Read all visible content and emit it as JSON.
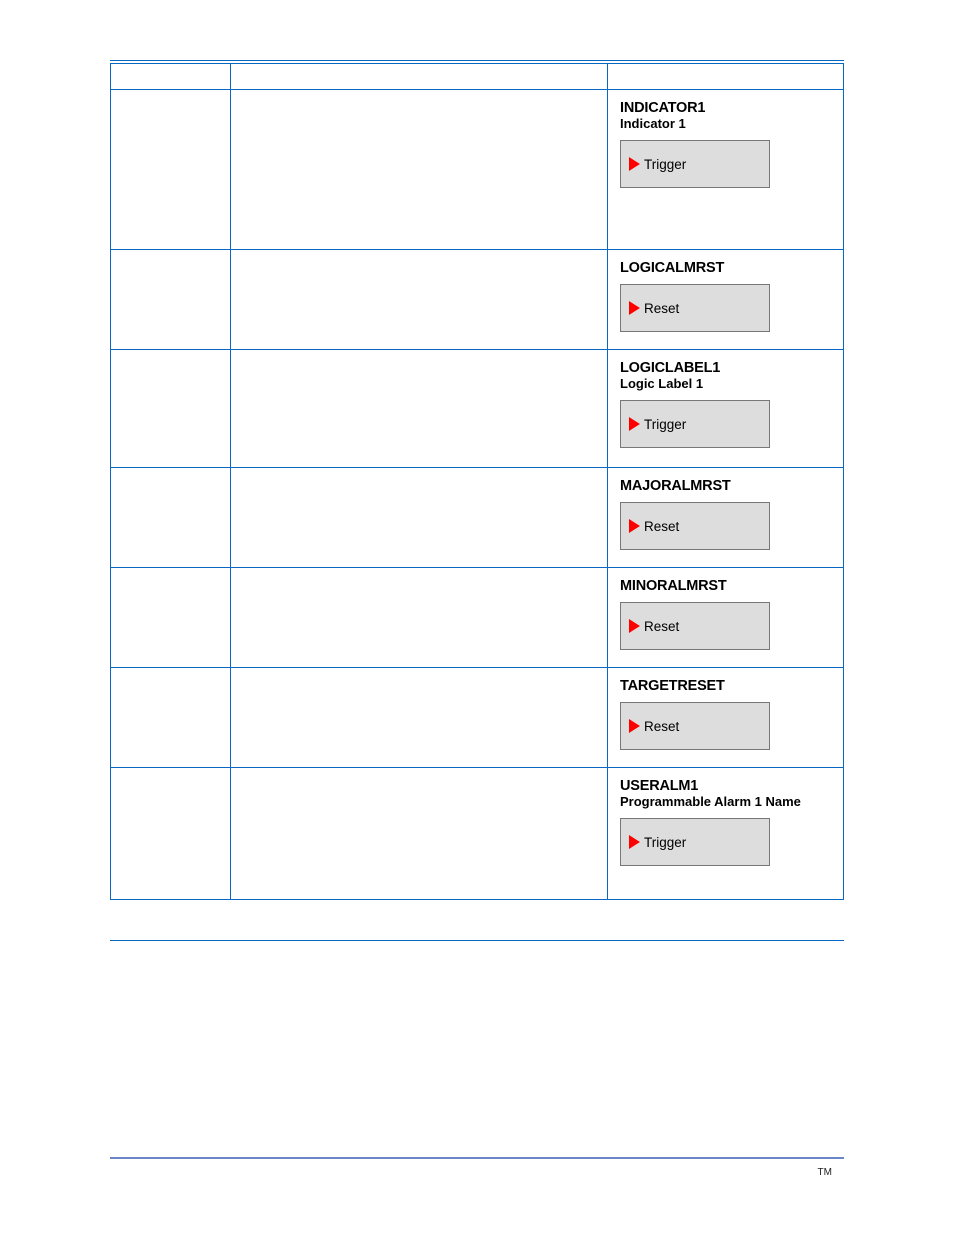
{
  "footer_symbol": "TM",
  "rows": [
    {
      "title": "INDICATOR1",
      "subtitle": "Indicator 1",
      "btn": "Trigger"
    },
    {
      "title": "LOGICALMRST",
      "subtitle": "",
      "btn": "Reset"
    },
    {
      "title": "LOGICLABEL1",
      "subtitle": "Logic Label 1",
      "btn": "Trigger"
    },
    {
      "title": "MAJORALMRST",
      "subtitle": "",
      "btn": "Reset"
    },
    {
      "title": "MINORALMRST",
      "subtitle": "",
      "btn": "Reset"
    },
    {
      "title": "TARGETRESET",
      "subtitle": "",
      "btn": "Reset"
    },
    {
      "title": "USERALM1",
      "subtitle": "Programmable Alarm 1 Name",
      "btn": "Trigger"
    }
  ]
}
